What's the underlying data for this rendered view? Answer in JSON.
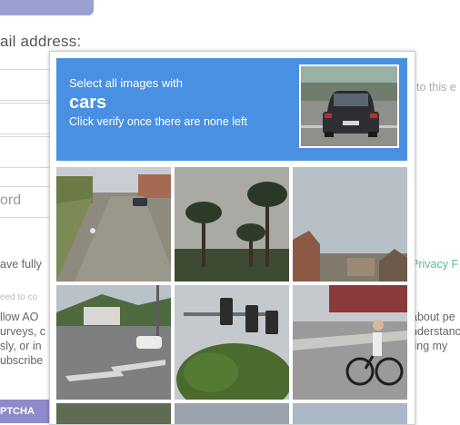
{
  "background": {
    "email_label": "ail address:",
    "password_placeholder": "ord",
    "right_text_1": "to this e",
    "right_text_2": "Privacy F",
    "right_text_3": "about pe",
    "right_text_4": "nderstanc",
    "right_text_5": "ting my",
    "left_text_1": "ave fully",
    "left_text_2": "eed to co",
    "left_text_3": "llow AO",
    "left_text_4": "urveys, c",
    "left_text_5": "sly, or in",
    "left_text_6": "ubscribe",
    "captcha_button": "PTCHA"
  },
  "challenge": {
    "instruction": "Select all images with",
    "target": "cars",
    "subtext": "Click verify once there are none left",
    "sample_image": "car-rear-view"
  },
  "tiles": [
    {
      "name": "tile-road-parked-car",
      "selected": false
    },
    {
      "name": "tile-palm-trees",
      "selected": false
    },
    {
      "name": "tile-sky-houses",
      "selected": false
    },
    {
      "name": "tile-intersection-car",
      "selected": false
    },
    {
      "name": "tile-traffic-lights",
      "selected": false
    },
    {
      "name": "tile-cyclist",
      "selected": false
    },
    {
      "name": "tile-partial-1",
      "selected": false
    },
    {
      "name": "tile-partial-2",
      "selected": false
    },
    {
      "name": "tile-partial-3",
      "selected": false
    }
  ]
}
